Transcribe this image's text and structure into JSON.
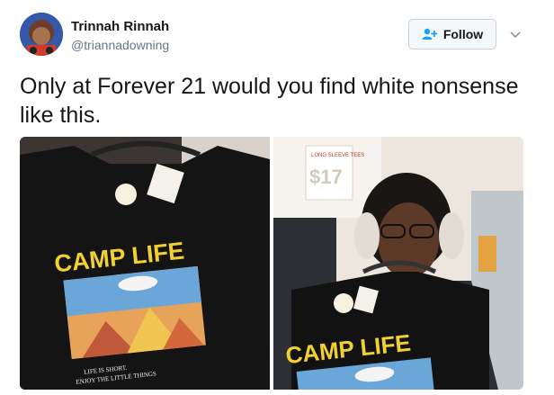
{
  "tweet": {
    "display_name": "Trinnah Rinnah",
    "handle": "@triannadowning",
    "text": "Only at Forever 21 would you find white nonsense like this.",
    "follow_label": "Follow",
    "avatar_icon": "user-avatar",
    "follow_icon": "add-user-icon",
    "caret_icon": "chevron-down-icon"
  },
  "media": {
    "left_shirt_text": "CAMP LIFE",
    "left_shirt_subtext_line1": "LIFE IS SHORT.",
    "left_shirt_subtext_line2": "ENJOY THE LITTLE THINGS",
    "right_shirt_text": "CAMP LIFE",
    "right_sign_price": "$17",
    "right_sign_header": "LONG SLEEVE TEES"
  },
  "colors": {
    "accent": "#1da1f2",
    "shirt_text": "#f2d12e"
  }
}
